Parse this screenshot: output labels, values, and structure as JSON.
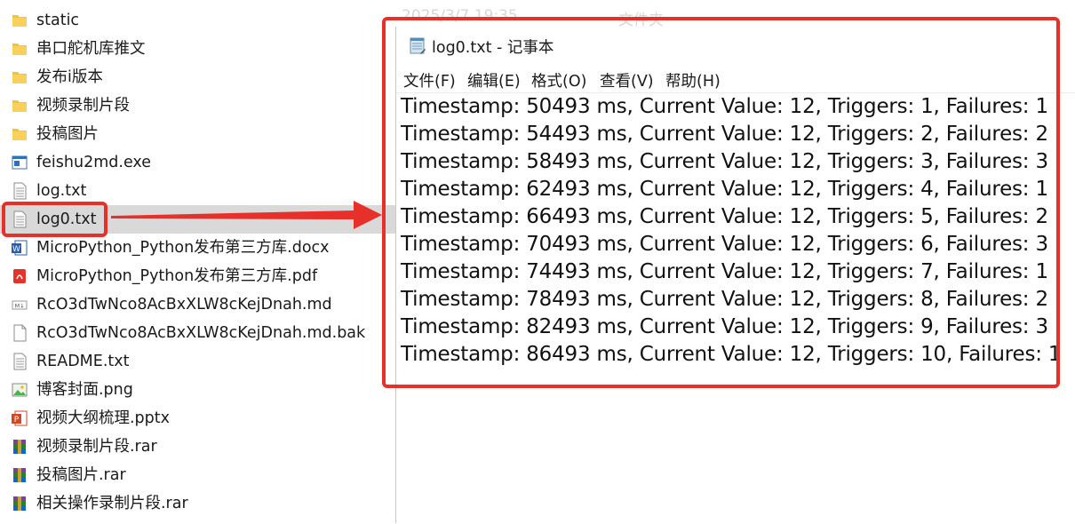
{
  "explorer": {
    "background_date": "2025/3/7 19:35",
    "background_type": "文件夹",
    "files": [
      {
        "name": "static",
        "icon": "folder-icon"
      },
      {
        "name": "串口舵机库推文",
        "icon": "folder-icon"
      },
      {
        "name": "发布i版本",
        "icon": "folder-icon"
      },
      {
        "name": "视频录制片段",
        "icon": "folder-icon"
      },
      {
        "name": "投稿图片",
        "icon": "folder-icon"
      },
      {
        "name": "feishu2md.exe",
        "icon": "exe-icon"
      },
      {
        "name": "log.txt",
        "icon": "text-file-icon"
      },
      {
        "name": "log0.txt",
        "icon": "text-file-icon",
        "selected": true
      },
      {
        "name": "MicroPython_Python发布第三方库.docx",
        "icon": "word-icon"
      },
      {
        "name": "MicroPython_Python发布第三方库.pdf",
        "icon": "pdf-icon"
      },
      {
        "name": "RcO3dTwNco8AcBxXLW8cKejDnah.md",
        "icon": "markdown-icon"
      },
      {
        "name": "RcO3dTwNco8AcBxXLW8cKejDnah.md.bak",
        "icon": "blank-file-icon"
      },
      {
        "name": "README.txt",
        "icon": "text-file-icon"
      },
      {
        "name": "博客封面.png",
        "icon": "image-icon"
      },
      {
        "name": "视频大纲梳理.pptx",
        "icon": "powerpoint-icon"
      },
      {
        "name": "视频录制片段.rar",
        "icon": "rar-icon"
      },
      {
        "name": "投稿图片.rar",
        "icon": "rar-icon"
      },
      {
        "name": "相关操作录制片段.rar",
        "icon": "rar-icon"
      }
    ]
  },
  "notepad": {
    "title": "log0.txt - 记事本",
    "menu": [
      "文件(F)",
      "编辑(E)",
      "格式(O)",
      "查看(V)",
      "帮助(H)"
    ],
    "lines": [
      "Timestamp: 50493 ms, Current Value: 12, Triggers: 1, Failures: 1",
      "Timestamp: 54493 ms, Current Value: 12, Triggers: 2, Failures: 2",
      "Timestamp: 58493 ms, Current Value: 12, Triggers: 3, Failures: 3",
      "Timestamp: 62493 ms, Current Value: 12, Triggers: 4, Failures: 1",
      "Timestamp: 66493 ms, Current Value: 12, Triggers: 5, Failures: 2",
      "Timestamp: 70493 ms, Current Value: 12, Triggers: 6, Failures: 3",
      "Timestamp: 74493 ms, Current Value: 12, Triggers: 7, Failures: 1",
      "Timestamp: 78493 ms, Current Value: 12, Triggers: 8, Failures: 2",
      "Timestamp: 82493 ms, Current Value: 12, Triggers: 9, Failures: 3",
      "Timestamp: 86493 ms, Current Value: 12, Triggers: 10, Failures: 1"
    ]
  },
  "colors": {
    "annotation": "#e8302a",
    "selection": "#d9d9d9",
    "folder": "#f3c33f"
  }
}
